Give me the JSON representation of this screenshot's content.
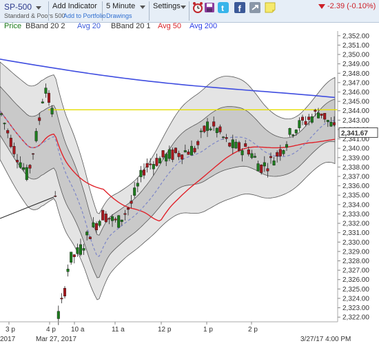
{
  "toolbar": {
    "symbol": "SP-500",
    "symbol_name": "Standard & Poors 500",
    "add_to_portfolio": "Add to Portfolio",
    "add_indicator": "Add Indicator",
    "interval": "5 Minute",
    "drawings": "Drawings",
    "settings": "Settings",
    "change": "-2.39 (-0.10%)"
  },
  "indicators": [
    {
      "label": "Price",
      "color": "#1a7a1a"
    },
    {
      "label": "BBand 20 2",
      "color": "#333333"
    },
    {
      "label": "Avg 20",
      "color": "#3b5bdb"
    },
    {
      "label": "BBand 20 1",
      "color": "#333333"
    },
    {
      "label": "Avg 50",
      "color": "#d9262c"
    },
    {
      "label": "Avg 200",
      "color": "#2b3ee8"
    }
  ],
  "chart_data": {
    "type": "candlestick",
    "ylim": [
      2321.5,
      2352.5
    ],
    "y_ticks": [
      "2,352.00",
      "2,351.00",
      "2,350.00",
      "2,349.00",
      "2,348.00",
      "2,347.00",
      "2,346.00",
      "2,345.00",
      "2,344.00",
      "2,343.00",
      "2,342.00",
      "2,341.00",
      "2,340.00",
      "2,339.00",
      "2,338.00",
      "2,337.00",
      "2,336.00",
      "2,335.00",
      "2,334.00",
      "2,333.00",
      "2,332.00",
      "2,331.00",
      "2,330.00",
      "2,329.00",
      "2,328.00",
      "2,327.00",
      "2,326.00",
      "2,325.00",
      "2,324.00",
      "2,323.00",
      "2,322.00"
    ],
    "x_ticks": [
      "3 p",
      "4 p",
      "10 a",
      "11 a",
      "12 p",
      "1 p",
      "2 p"
    ],
    "date_labels": [
      "2017",
      "Mar 27, 2017"
    ],
    "current_price": "2,341.67",
    "resistance_level": 2344.1,
    "timestamp": "3/27/17 4:00 PM",
    "colors": {
      "up": "#1e7b1e",
      "down": "#a8191f",
      "avg20": "#7d86c7",
      "avg50": "#e0222a",
      "avg200": "#3f4de0",
      "resistance": "#e5de00"
    }
  }
}
